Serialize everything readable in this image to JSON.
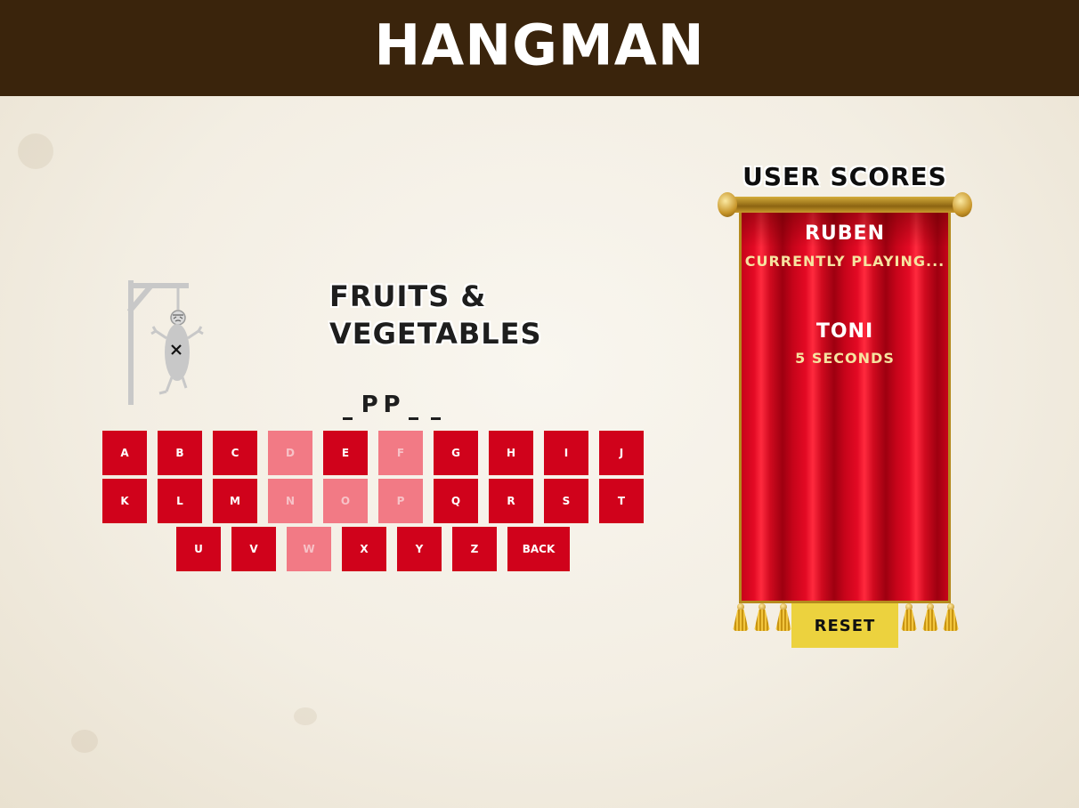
{
  "header": {
    "title": "HANGMAN"
  },
  "game": {
    "category_line1": "FRUITS &",
    "category_line2": "VEGETABLES",
    "word_slots": [
      "",
      "P",
      "P",
      "",
      ""
    ],
    "hangman_stage": "complete"
  },
  "keyboard": {
    "rows": [
      [
        {
          "label": "A",
          "used": false
        },
        {
          "label": "B",
          "used": false
        },
        {
          "label": "C",
          "used": false
        },
        {
          "label": "D",
          "used": true
        },
        {
          "label": "E",
          "used": false
        },
        {
          "label": "F",
          "used": true
        },
        {
          "label": "G",
          "used": false
        },
        {
          "label": "H",
          "used": false
        },
        {
          "label": "I",
          "used": false
        },
        {
          "label": "J",
          "used": false
        }
      ],
      [
        {
          "label": "K",
          "used": false
        },
        {
          "label": "L",
          "used": false
        },
        {
          "label": "M",
          "used": false
        },
        {
          "label": "N",
          "used": true
        },
        {
          "label": "O",
          "used": true
        },
        {
          "label": "P",
          "used": true
        },
        {
          "label": "Q",
          "used": false
        },
        {
          "label": "R",
          "used": false
        },
        {
          "label": "S",
          "used": false
        },
        {
          "label": "T",
          "used": false
        }
      ],
      [
        {
          "label": "U",
          "used": false
        },
        {
          "label": "V",
          "used": false
        },
        {
          "label": "W",
          "used": true
        },
        {
          "label": "X",
          "used": false
        },
        {
          "label": "Y",
          "used": false
        },
        {
          "label": "Z",
          "used": false
        },
        {
          "label": "BACK",
          "used": false
        }
      ]
    ]
  },
  "scores": {
    "title": "USER SCORES",
    "players": [
      {
        "name": "RUBEN",
        "status": "CURRENTLY PLAYING..."
      },
      {
        "name": "TONI",
        "status": "5 SECONDS"
      }
    ],
    "reset_label": "RESET"
  },
  "colors": {
    "header_bg": "#3a240c",
    "key_active": "#d0021b",
    "key_used": "#f27a85",
    "banner_red": "#e30a24",
    "reset_yellow": "#ecd23e"
  }
}
